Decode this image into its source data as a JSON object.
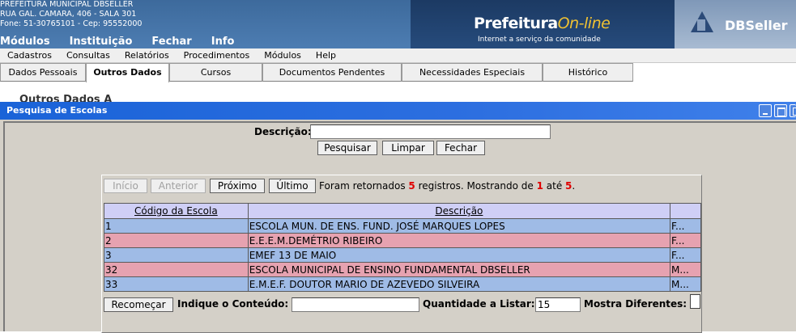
{
  "header": {
    "org_lines": [
      "PREFEITURA MUNICIPAL DBSELLER",
      "RUA GAL. CAMARA, 406 - SALA 301",
      "Fone: 51-30765101  -  Cep: 95552000"
    ],
    "menu": [
      "Módulos",
      "Instituição",
      "Fechar",
      "Info"
    ],
    "portal_title": "Prefeitura",
    "portal_title_accent": "On-line",
    "portal_slogan": "Internet a serviço da comunidade",
    "brand": "DBSeller"
  },
  "menubar": [
    "Cadastros",
    "Consultas",
    "Relatórios",
    "Procedimentos",
    "Módulos",
    "Help"
  ],
  "tabs": [
    {
      "label": "Dados Pessoais",
      "active": false
    },
    {
      "label": "Outros Dados",
      "active": true
    },
    {
      "label": "Cursos",
      "active": false
    },
    {
      "label": "Documentos Pendentes",
      "active": false
    },
    {
      "label": "Necessidades Especiais",
      "active": false
    },
    {
      "label": "Histórico",
      "active": false
    }
  ],
  "background_text": "Outros Dados A",
  "dialog": {
    "title": "Pesquisa de Escolas",
    "descricao_label": "Descrição:",
    "descricao_value": "",
    "buttons": {
      "pesquisar": "Pesquisar",
      "limpar": "Limpar",
      "fechar": "Fechar"
    },
    "pager": {
      "inicio": "Início",
      "anterior": "Anterior",
      "proximo": "Próximo",
      "ultimo": "Último"
    },
    "info": {
      "prefix": "Foram retornados ",
      "count": "5",
      "mid": " registros. Mostrando de ",
      "from": "1",
      "ate": " até ",
      "to": "5",
      "suffix": "."
    },
    "columns": [
      "Código da Escola",
      "Descrição",
      ""
    ],
    "rows": [
      {
        "code": "1",
        "desc": "ESCOLA MUN. DE ENS. FUND. JOSÉ MARQUES LOPES",
        "extra": "F..."
      },
      {
        "code": "2",
        "desc": "E.E.E.M.DEMÉTRIO RIBEIRO",
        "extra": "F..."
      },
      {
        "code": "3",
        "desc": "EMEF 13 DE MAIO",
        "extra": "F..."
      },
      {
        "code": "32",
        "desc": "ESCOLA MUNICIPAL DE ENSINO FUNDAMENTAL DBSELLER",
        "extra": "M..."
      },
      {
        "code": "33",
        "desc": "E.M.E.F. DOUTOR MARIO DE AZEVEDO SILVEIRA",
        "extra": "M..."
      }
    ],
    "footer": {
      "recomecar": "Recomeçar",
      "indique_label": "Indique o Conteúdo:",
      "indique_value": "",
      "quantidade_label": "Quantidade a Listar:",
      "quantidade_value": "15",
      "mostra_label": "Mostra Diferentes:"
    }
  },
  "colors": {
    "row_blue": "#9fbbe6",
    "row_pink": "#e6a2b0",
    "header_row": "#cfcff6",
    "titlebar": "#1a63d8"
  }
}
